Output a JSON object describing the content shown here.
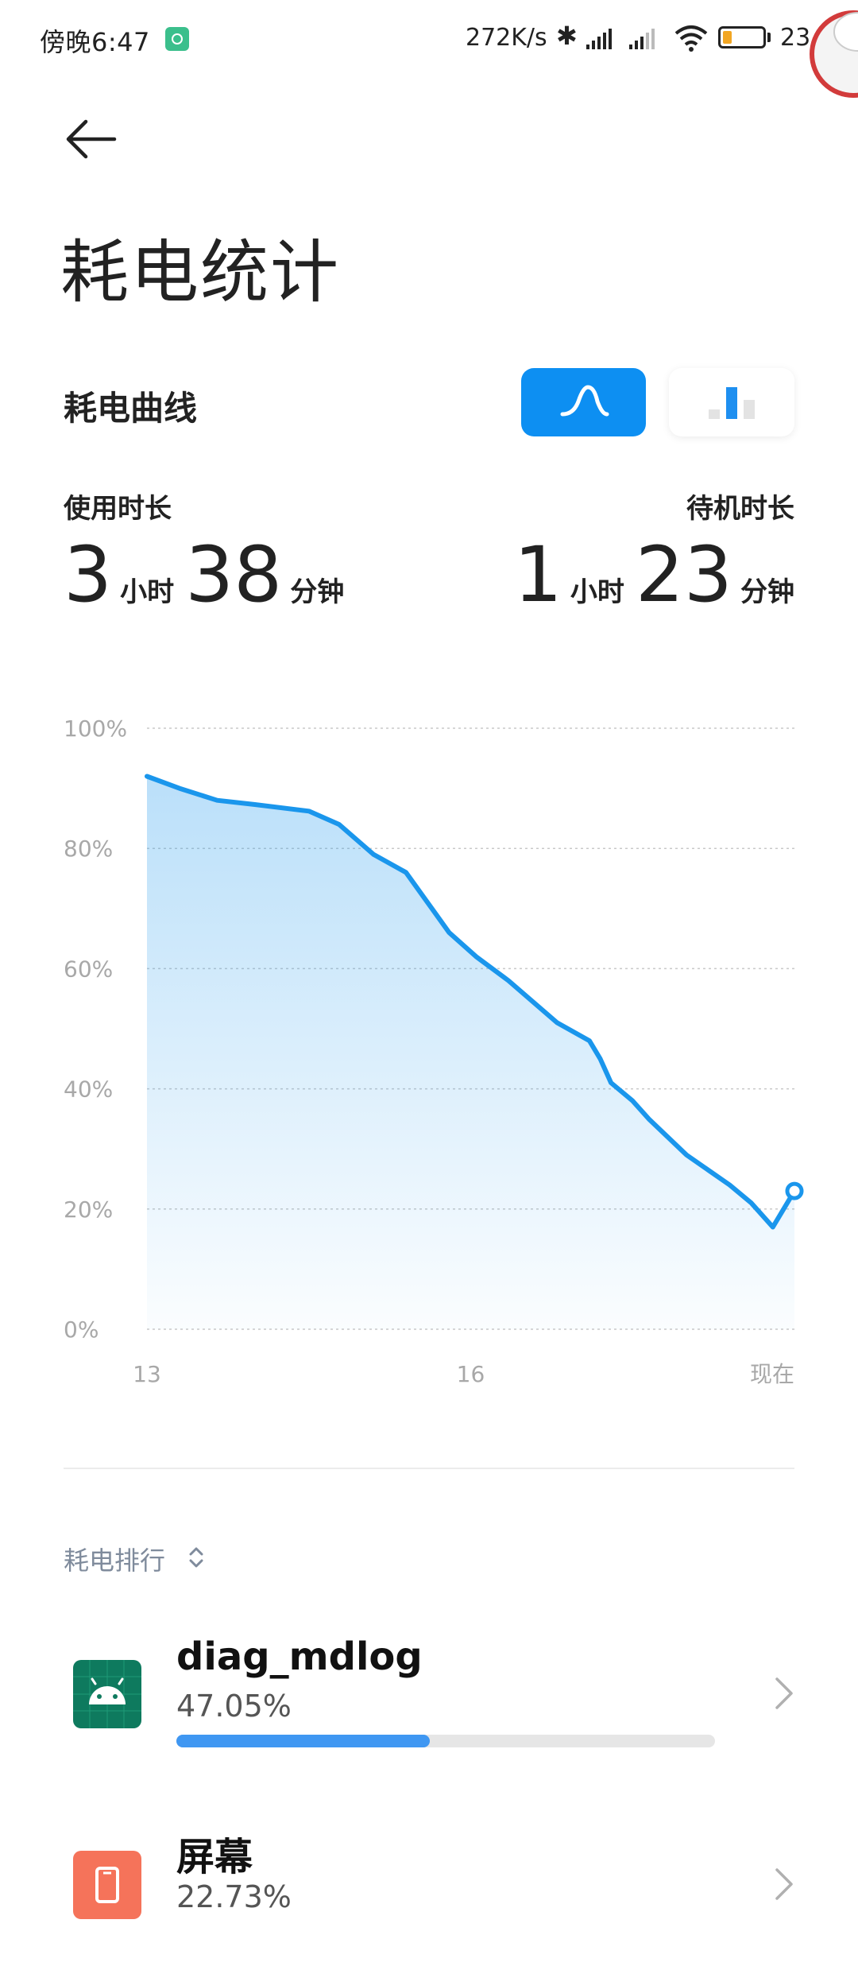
{
  "status_bar": {
    "time": "傍晚6:47",
    "speed": "272K/s",
    "bluetooth": "✱",
    "battery_percent": "23",
    "battery_level": 0.23
  },
  "header": {
    "back_icon": "back-arrow-icon",
    "title": "耗电统计"
  },
  "section": {
    "title": "耗电曲线",
    "toggle_options": [
      "curve-icon",
      "bar-chart-icon"
    ],
    "selected_toggle": "curve"
  },
  "stats": {
    "usage": {
      "label": "使用时长",
      "hours": "3",
      "hour_unit": "小时",
      "minutes": "38",
      "minute_unit": "分钟"
    },
    "standby": {
      "label": "待机时长",
      "hours": "1",
      "hour_unit": "小时",
      "minutes": "23",
      "minute_unit": "分钟"
    }
  },
  "chart_data": {
    "type": "area",
    "y_ticks": [
      "100%",
      "80%",
      "60%",
      "40%",
      "20%",
      "0%"
    ],
    "y_tick_values": [
      100,
      80,
      60,
      40,
      20,
      0
    ],
    "x_ticks": [
      "13",
      "16",
      "现在"
    ],
    "x_tick_values": [
      13,
      16,
      19
    ],
    "ylim": [
      0,
      100
    ],
    "xlim": [
      13,
      19
    ],
    "grid": true,
    "line_color": "#1a96ec",
    "x": [
      13.0,
      13.3,
      13.65,
      14.0,
      14.5,
      14.78,
      15.1,
      15.4,
      15.6,
      15.8,
      16.05,
      16.35,
      16.8,
      17.1,
      17.2,
      17.3,
      17.5,
      17.65,
      18.0,
      18.4,
      18.6,
      18.8,
      19.0
    ],
    "values": [
      92,
      90,
      88,
      87.3,
      86.2,
      84,
      79,
      76,
      71,
      66,
      62,
      58,
      51,
      48,
      45,
      41,
      38,
      35,
      29,
      24,
      21,
      17,
      23
    ]
  },
  "ranking": {
    "label": "耗电排行",
    "sort_icon": "sort-updown-icon",
    "items": [
      {
        "name": "diag_mdlog",
        "percent": "47.05%",
        "fraction": 0.4705,
        "icon": "android-icon",
        "icon_color": "#0e7a5e"
      },
      {
        "name": "屏幕",
        "percent": "22.73%",
        "fraction": 0.2273,
        "icon": "phone-screen-icon",
        "icon_color": "#f5735a"
      }
    ]
  }
}
